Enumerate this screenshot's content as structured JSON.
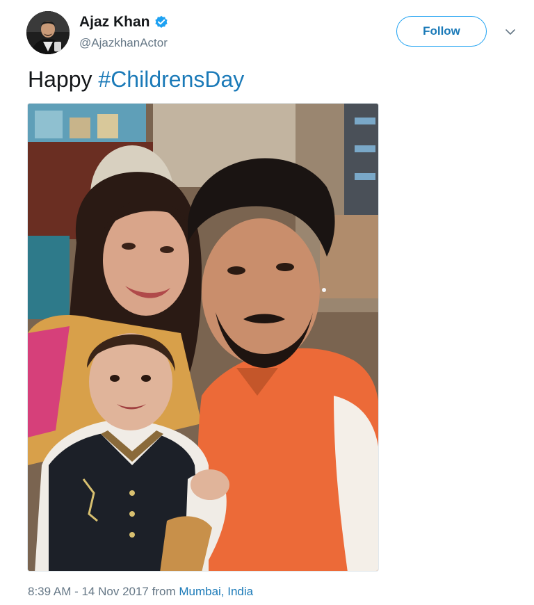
{
  "author": {
    "display_name": "Ajaz Khan",
    "handle": "@AjazkhanActor",
    "verified_icon": "verified-badge-icon",
    "avatar_icon": "profile-photo"
  },
  "actions": {
    "follow_label": "Follow",
    "more_icon": "chevron-down-icon"
  },
  "tweet": {
    "text_prefix": "Happy ",
    "hashtag": "#ChildrensDay"
  },
  "media": {
    "kind": "photo",
    "subject": "selfie-photo"
  },
  "meta": {
    "time": "8:39 AM - 14 Nov 2017",
    "from_label": " from ",
    "location": "Mumbai, India"
  },
  "colors": {
    "accent": "#1da1f2",
    "link": "#1b7ab8",
    "secondary_text": "#657786",
    "primary_text": "#14171a",
    "border": "#e1e8ed"
  }
}
